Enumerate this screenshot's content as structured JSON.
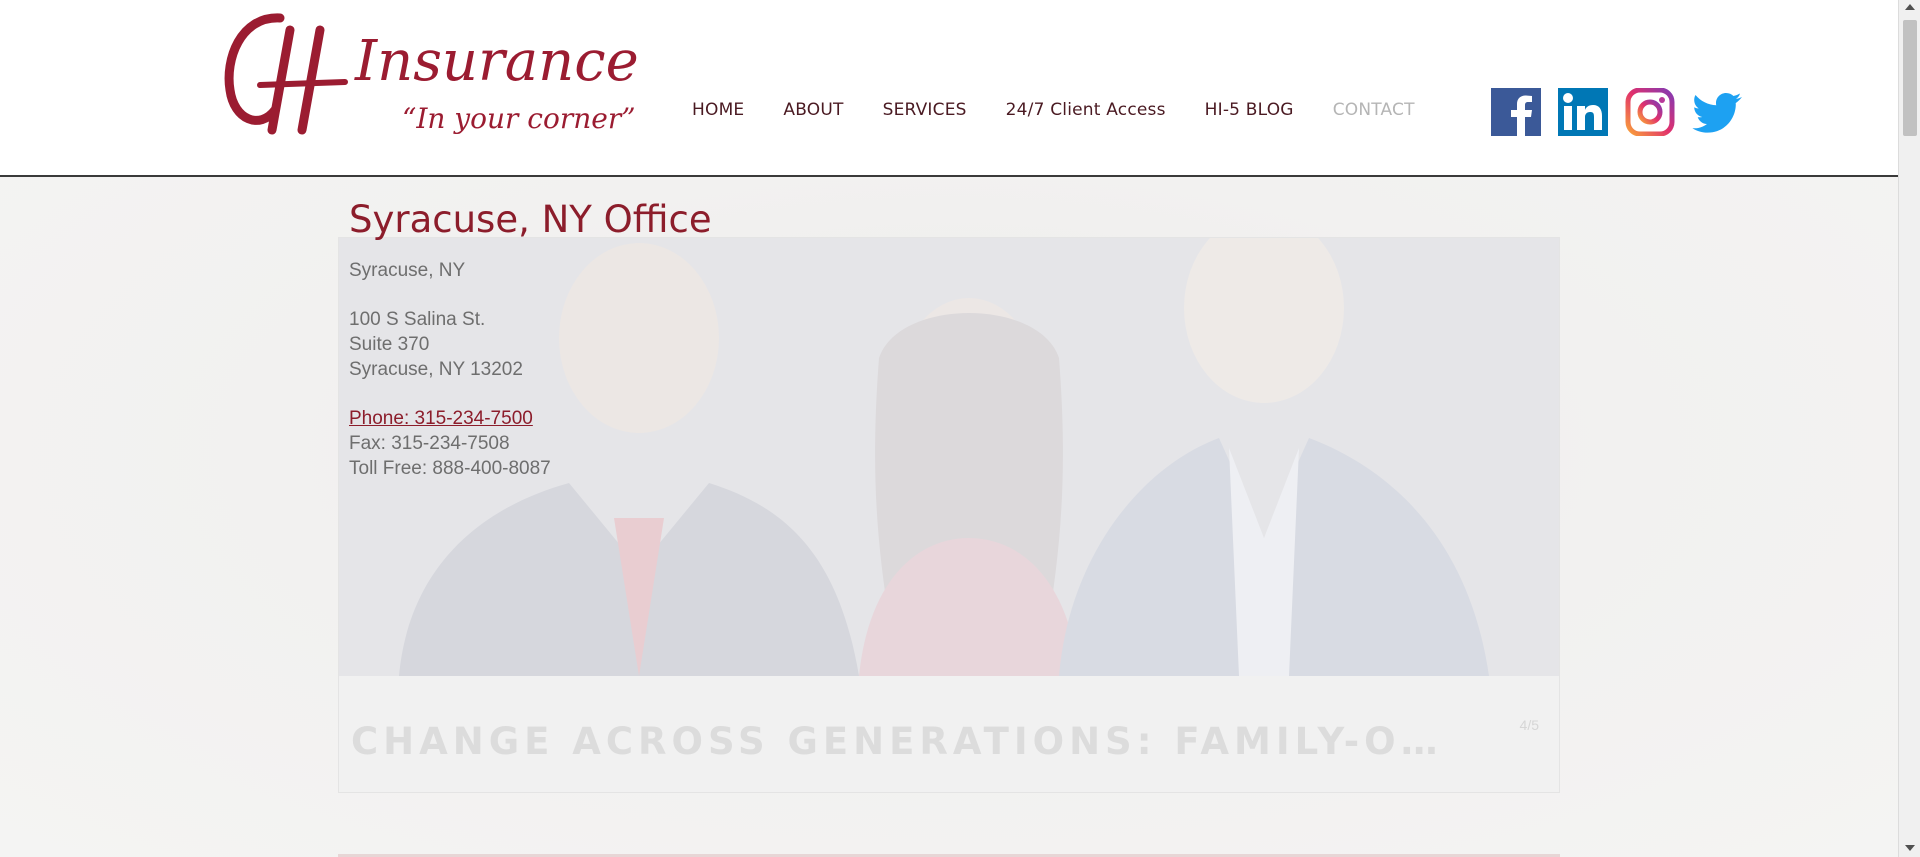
{
  "logo": {
    "monogram": "CH",
    "brand": "Insurance",
    "tagline": "“In your corner”",
    "brand_color": "#9b1c31"
  },
  "nav": {
    "items": [
      {
        "label": "HOME"
      },
      {
        "label": "ABOUT"
      },
      {
        "label": "SERVICES"
      },
      {
        "label": "24/7 Client Access"
      },
      {
        "label": "HI-5 BLOG"
      },
      {
        "label": "CONTACT",
        "active": true
      }
    ]
  },
  "socials": [
    {
      "icon": "facebook-icon",
      "color": "#3b5998"
    },
    {
      "icon": "linkedin-icon",
      "color": "#0077b5"
    },
    {
      "icon": "instagram-icon",
      "color": "#c13584"
    },
    {
      "icon": "twitter-icon",
      "color": "#1da1f2"
    }
  ],
  "office": {
    "title": "Syracuse, NY Office",
    "city": "Syracuse, NY",
    "address1": "100 S Salina St.",
    "address2": "Suite 370",
    "address3": "Syracuse, NY 13202",
    "phone": "Phone: 315-234-7500",
    "fax": "Fax: 315-234-7508",
    "tollfree": "Toll Free: 888-400-8087"
  },
  "card": {
    "headline": "CHANGE ACROSS GENERATIONS: FAMILY-O…",
    "counter": "4/5"
  }
}
